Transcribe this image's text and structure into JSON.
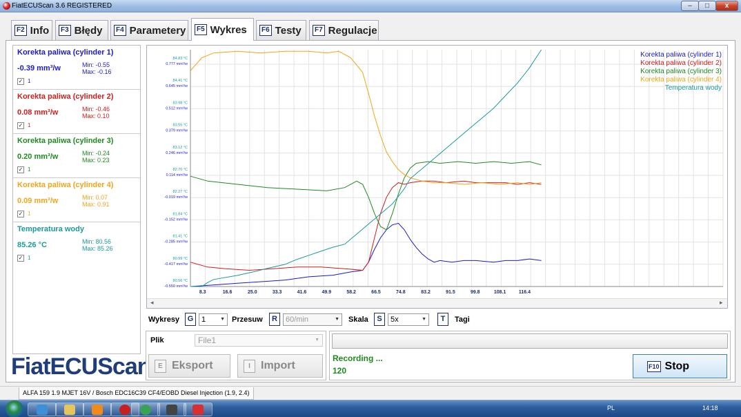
{
  "window": {
    "title": "FiatECUScan 3.6 REGISTERED",
    "min_glyph": "–",
    "max_glyph": "□",
    "close_glyph": "x"
  },
  "tabs": [
    {
      "key": "F2",
      "label": "Info"
    },
    {
      "key": "F3",
      "label": "Błędy"
    },
    {
      "key": "F4",
      "label": "Parametery"
    },
    {
      "key": "F5",
      "label": "Wykres",
      "active": true
    },
    {
      "key": "F6",
      "label": "Testy"
    },
    {
      "key": "F7",
      "label": "Regulacje"
    }
  ],
  "sensors": [
    {
      "name": "Korekta paliwa (cylinder 1)",
      "value": "-0.39 mm³/w",
      "min": "Min: -0.55",
      "max": "Max: -0.16",
      "check_label": "1",
      "color": "#1a1acd"
    },
    {
      "name": "Korekta paliwa (cylinder 2)",
      "value": "0.08 mm³/w",
      "min": "Min: -0.46",
      "max": "Max: 0.10",
      "check_label": "1",
      "color": "#d21c1c"
    },
    {
      "name": "Korekta paliwa (cylinder 3)",
      "value": "0.20 mm³/w",
      "min": "Min: -0.24",
      "max": "Max: 0.23",
      "check_label": "1",
      "color": "#1e8a1e"
    },
    {
      "name": "Korekta paliwa (cylinder 4)",
      "value": "0.09 mm³/w",
      "min": "Min: 0.07",
      "max": "Max: 0.91",
      "check_label": "1",
      "color": "#f2a516"
    },
    {
      "name": "Temperatura wody",
      "value": "85.26 °C",
      "min": "Min: 80.56",
      "max": "Max: 85.26",
      "check_label": "1",
      "color": "#1a9a9a"
    }
  ],
  "logo": "FiatECUScan",
  "chart_data": {
    "type": "line",
    "x_ticks": [
      "8.3",
      "16.6",
      "25.0",
      "33.3",
      "41.6",
      "49.9",
      "58.2",
      "66.5",
      "74.8",
      "83.2",
      "91.5",
      "99.8",
      "108.1",
      "116.4"
    ],
    "y_ticks_temp": [
      "84.83 °C",
      "84.41 °C",
      "83.98 °C",
      "83.55 °C",
      "83.12 °C",
      "82.70 °C",
      "82.27 °C",
      "81.84 °C",
      "81.41 °C",
      "80.99 °C",
      "80.56 °C"
    ],
    "y_ticks_fuel": [
      "0.777 mm³/w",
      "0.645 mm³/w",
      "0.512 mm³/w",
      "0.379 mm³/w",
      "0.246 mm³/w",
      "0.114 mm³/w",
      "-0.019 mm³/w",
      "-0.152 mm³/w",
      "-0.285 mm³/w",
      "-0.417 mm³/w",
      "-0.550 mm³/w"
    ],
    "xlim": [
      4.2,
      183
    ],
    "ylim": [
      -0.55,
      0.91
    ],
    "temp_axis": {
      "min": 80.56,
      "max": 85.26
    },
    "series": [
      {
        "name": "Korekta paliwa (cylinder 1)",
        "color": "#1a1acd",
        "x": [
          4.2,
          12,
          20,
          28,
          36,
          44,
          52,
          58,
          62,
          64,
          66,
          68,
          70,
          72,
          74,
          76,
          78,
          80,
          82,
          84,
          86,
          88,
          92,
          96,
          100,
          106,
          110,
          114,
          118,
          122
        ],
        "y": [
          -0.55,
          -0.54,
          -0.53,
          -0.52,
          -0.51,
          -0.49,
          -0.48,
          -0.46,
          -0.45,
          -0.4,
          -0.32,
          -0.25,
          -0.2,
          -0.17,
          -0.16,
          -0.2,
          -0.26,
          -0.31,
          -0.35,
          -0.38,
          -0.4,
          -0.39,
          -0.4,
          -0.39,
          -0.39,
          -0.4,
          -0.39,
          -0.39,
          -0.38,
          -0.39
        ]
      },
      {
        "name": "Korekta paliwa (cylinder 2)",
        "color": "#d21c1c",
        "x": [
          4.2,
          10,
          16,
          24,
          32,
          40,
          48,
          56,
          62,
          64,
          66,
          68,
          70,
          72,
          74,
          76,
          78,
          82,
          86,
          90,
          96,
          100,
          106,
          110,
          114,
          118,
          122
        ],
        "y": [
          -0.4,
          -0.43,
          -0.44,
          -0.45,
          -0.44,
          -0.43,
          -0.43,
          -0.44,
          -0.45,
          -0.4,
          -0.25,
          -0.1,
          0.0,
          0.06,
          0.09,
          0.08,
          0.09,
          0.1,
          0.1,
          0.09,
          0.1,
          0.09,
          0.09,
          0.09,
          0.08,
          0.09,
          0.08
        ]
      },
      {
        "name": "Korekta paliwa (cylinder 3)",
        "color": "#1e8a1e",
        "x": [
          4.2,
          10,
          20,
          30,
          40,
          50,
          56,
          60,
          62,
          64,
          66,
          68,
          70,
          72,
          74,
          76,
          78,
          80,
          84,
          88,
          94,
          100,
          106,
          112,
          118,
          122
        ],
        "y": [
          0.13,
          0.1,
          0.08,
          0.06,
          0.05,
          0.04,
          0.06,
          0.1,
          0.08,
          0.0,
          -0.1,
          -0.18,
          -0.2,
          -0.1,
          0.02,
          0.12,
          0.18,
          0.21,
          0.22,
          0.21,
          0.22,
          0.21,
          0.22,
          0.21,
          0.22,
          0.2
        ]
      },
      {
        "name": "Korekta paliwa (cylinder 4)",
        "color": "#f2a516",
        "x": [
          4.2,
          8,
          12,
          20,
          28,
          36,
          44,
          50,
          54,
          58,
          62,
          64,
          66,
          68,
          70,
          72,
          74,
          76,
          78,
          82,
          86,
          90,
          96,
          102,
          108,
          114,
          118,
          122
        ],
        "y": [
          0.78,
          0.86,
          0.89,
          0.9,
          0.89,
          0.9,
          0.9,
          0.89,
          0.9,
          0.86,
          0.77,
          0.64,
          0.5,
          0.38,
          0.28,
          0.22,
          0.17,
          0.14,
          0.12,
          0.1,
          0.09,
          0.09,
          0.08,
          0.09,
          0.08,
          0.09,
          0.08,
          0.09
        ]
      },
      {
        "name": "Temperatura wody",
        "color": "#1a9a9a",
        "x": [
          4.2,
          8,
          10,
          12,
          20,
          26,
          30,
          36,
          40,
          44,
          48,
          52,
          56,
          58,
          60,
          62,
          64,
          66,
          68,
          70,
          72,
          74,
          76,
          78,
          82,
          86,
          90,
          94,
          98,
          102,
          106,
          110,
          114,
          118,
          122
        ],
        "y": [
          80.56,
          80.56,
          80.64,
          80.7,
          80.78,
          80.86,
          80.92,
          81.0,
          81.1,
          81.18,
          81.26,
          81.34,
          81.4,
          81.5,
          81.6,
          81.7,
          81.8,
          81.9,
          82.0,
          82.1,
          82.2,
          82.35,
          82.5,
          82.7,
          82.9,
          83.1,
          83.3,
          83.5,
          83.7,
          83.9,
          84.1,
          84.35,
          84.6,
          84.9,
          85.26
        ]
      }
    ]
  },
  "controls": {
    "wykresy_label": "Wykresy",
    "wykresy_key": "G",
    "wykresy_value": "1",
    "przesuw_label": "Przesuw",
    "przesuw_key": "R",
    "przesuw_value": "60/min",
    "skala_label": "Skala",
    "skala_key": "S",
    "skala_value": "5x",
    "tagi_key": "T",
    "tagi_label": "Tagi"
  },
  "plik": {
    "label": "Plik",
    "value": "File1"
  },
  "export_button": {
    "key": "E",
    "label": "Eksport"
  },
  "import_button": {
    "key": "I",
    "label": "Import"
  },
  "recording": {
    "status": "Recording ...",
    "count": "120"
  },
  "stop_button": {
    "key": "F10",
    "label": "Stop"
  },
  "statusbar": {
    "vehicle": "ALFA 159 1.9 MJET 16V / Bosch EDC16C39 CF4/EOBD Diesel Injection (1.9, 2.4)"
  },
  "taskbar": {
    "lang": "PL",
    "time": "14:18"
  }
}
